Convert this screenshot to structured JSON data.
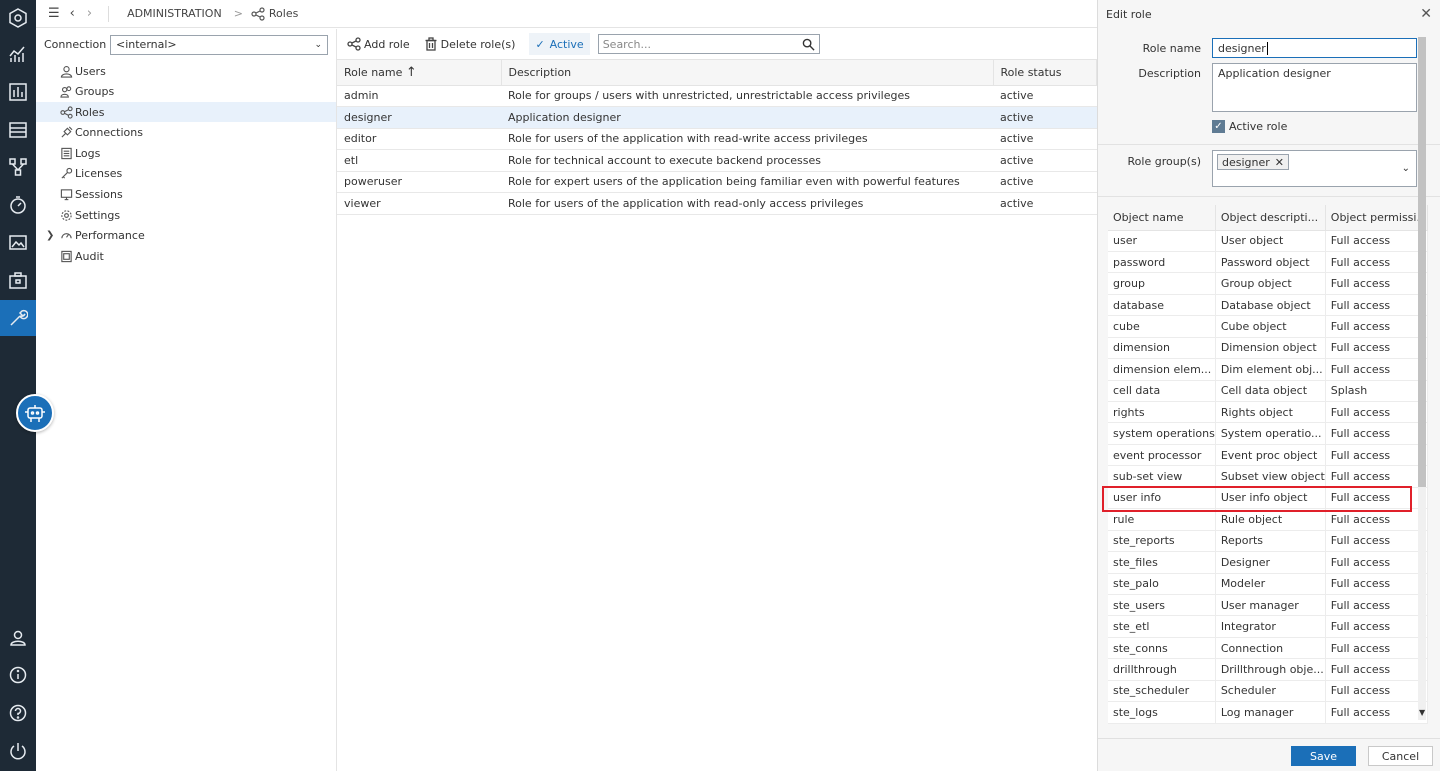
{
  "rail": {
    "icons": [
      "hexagon-icon",
      "analytics-icon",
      "report-icon",
      "list-icon",
      "modeler-icon",
      "scheduler-icon",
      "gallery-icon",
      "briefcase-icon",
      "tools-icon",
      "user-icon",
      "info-icon",
      "help-icon",
      "power-icon"
    ]
  },
  "topbar": {
    "crumb1": "ADMINISTRATION",
    "crumb2": "Roles"
  },
  "tree": {
    "connection_label": "Connection",
    "connection_value": "<internal>",
    "items": [
      {
        "label": "Users",
        "icon": "user-icon"
      },
      {
        "label": "Groups",
        "icon": "group-icon"
      },
      {
        "label": "Roles",
        "icon": "share-icon"
      },
      {
        "label": "Connections",
        "icon": "plug-icon"
      },
      {
        "label": "Logs",
        "icon": "log-icon"
      },
      {
        "label": "Licenses",
        "icon": "key-icon"
      },
      {
        "label": "Sessions",
        "icon": "monitor-icon"
      },
      {
        "label": "Settings",
        "icon": "gear-icon"
      },
      {
        "label": "Performance",
        "icon": "gauge-icon"
      },
      {
        "label": "Audit",
        "icon": "audit-icon"
      }
    ]
  },
  "toolbar": {
    "add_role": "Add role",
    "delete_roles": "Delete role(s)",
    "active": "Active",
    "search_placeholder": "Search..."
  },
  "roles_table": {
    "headers": [
      "Role name",
      "Description",
      "Role status"
    ],
    "rows": [
      {
        "name": "admin",
        "description": "Role for groups / users with unrestricted, unrestrictable access privileges",
        "status": "active"
      },
      {
        "name": "designer",
        "description": "Application designer",
        "status": "active"
      },
      {
        "name": "editor",
        "description": "Role for users of the application with read-write access privileges",
        "status": "active"
      },
      {
        "name": "etl",
        "description": "Role for technical account to execute backend processes",
        "status": "active"
      },
      {
        "name": "poweruser",
        "description": "Role for expert users of the application being familiar even with powerful features",
        "status": "active"
      },
      {
        "name": "viewer",
        "description": "Role for users of the application with read-only access privileges",
        "status": "active"
      }
    ]
  },
  "edit_role": {
    "title": "Edit role",
    "role_name_label": "Role name",
    "role_name_value": "designer",
    "description_label": "Description",
    "description_value": "Application designer",
    "active_label": "Active role",
    "groups_label": "Role group(s)",
    "group_chip": "designer",
    "save": "Save",
    "cancel": "Cancel",
    "headers": [
      "Object name",
      "Object descripti...",
      "Object permissi..."
    ],
    "objects": [
      [
        "user",
        "User object",
        "Full access"
      ],
      [
        "password",
        "Password object",
        "Full access"
      ],
      [
        "group",
        "Group object",
        "Full access"
      ],
      [
        "database",
        "Database object",
        "Full access"
      ],
      [
        "cube",
        "Cube object",
        "Full access"
      ],
      [
        "dimension",
        "Dimension object",
        "Full access"
      ],
      [
        "dimension elem...",
        "Dim element obj...",
        "Full access"
      ],
      [
        "cell data",
        "Cell data object",
        "Splash"
      ],
      [
        "rights",
        "Rights object",
        "Full access"
      ],
      [
        "system operations",
        "System operatio...",
        "Full access"
      ],
      [
        "event processor",
        "Event proc object",
        "Full access"
      ],
      [
        "sub-set view",
        "Subset view object",
        "Full access"
      ],
      [
        "user info",
        "User info object",
        "Full access"
      ],
      [
        "rule",
        "Rule object",
        "Full access"
      ],
      [
        "ste_reports",
        "Reports",
        "Full access"
      ],
      [
        "ste_files",
        "Designer",
        "Full access"
      ],
      [
        "ste_palo",
        "Modeler",
        "Full access"
      ],
      [
        "ste_users",
        "User manager",
        "Full access"
      ],
      [
        "ste_etl",
        "Integrator",
        "Full access"
      ],
      [
        "ste_conns",
        "Connection",
        "Full access"
      ],
      [
        "drillthrough",
        "Drillthrough obje...",
        "Full access"
      ],
      [
        "ste_scheduler",
        "Scheduler",
        "Full access"
      ],
      [
        "ste_logs",
        "Log manager",
        "Full access"
      ]
    ]
  },
  "colors": {
    "accent": "#1b6fb8",
    "rail": "#1e2a36",
    "highlight": "#e0202a"
  }
}
